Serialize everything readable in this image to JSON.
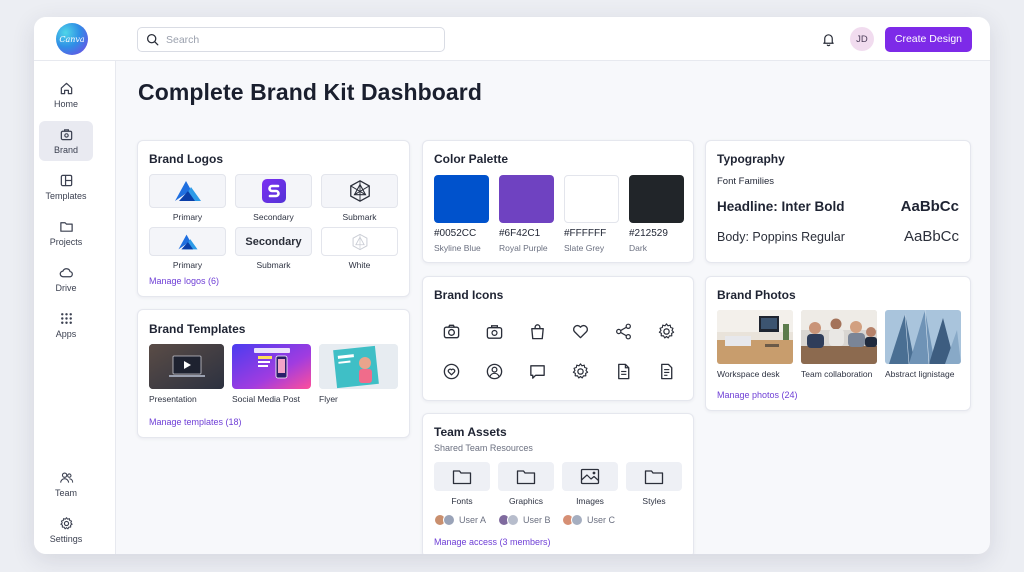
{
  "app": {
    "logo_text": "Canva"
  },
  "search": {
    "placeholder": "Search"
  },
  "header": {
    "avatar_initials": "JD",
    "create_label": "Create Design"
  },
  "sidebar": {
    "items": [
      {
        "label": "Home",
        "icon": "home-icon"
      },
      {
        "label": "Brand",
        "icon": "brand-kit-icon",
        "active": true
      },
      {
        "label": "Templates",
        "icon": "templates-icon"
      },
      {
        "label": "Projects",
        "icon": "folder-icon"
      },
      {
        "label": "Drive",
        "icon": "cloud-icon"
      },
      {
        "label": "Apps",
        "icon": "apps-grid-icon"
      }
    ],
    "bottom_items": [
      {
        "label": "Team",
        "icon": "team-icon"
      },
      {
        "label": "Settings",
        "icon": "gear-icon"
      }
    ]
  },
  "page": {
    "title": "Complete Brand Kit Dashboard"
  },
  "logos": {
    "title": "Brand Logos",
    "tiles": [
      {
        "label": "Primary"
      },
      {
        "label": "Secondary"
      },
      {
        "label": "Submark"
      },
      {
        "label": "Primary"
      },
      {
        "label": "Submark",
        "wordmark": "Secondary"
      },
      {
        "label": "White"
      }
    ],
    "manage": "Manage logos (6)"
  },
  "templates": {
    "title": "Brand Templates",
    "items": [
      {
        "label": "Presentation"
      },
      {
        "label": "Social Media Post"
      },
      {
        "label": "Flyer"
      }
    ],
    "manage": "Manage templates (18)"
  },
  "palette": {
    "title": "Color Palette",
    "colors": [
      {
        "hex": "#0052CC",
        "name": "Skyline Blue"
      },
      {
        "hex": "#6F42C1",
        "name": "Royal Purple"
      },
      {
        "hex": "#FFFFFF",
        "name": "Slate Grey"
      },
      {
        "hex": "#212529",
        "name": "Dark"
      }
    ]
  },
  "icons": {
    "title": "Brand Icons",
    "row1": [
      "camera-icon",
      "briefcase-icon",
      "shopping-bag-icon",
      "heart-icon",
      "share-icon",
      "gear-icon"
    ],
    "row2": [
      "heart-circle-icon",
      "user-circle-icon",
      "chat-icon",
      "settings-icon",
      "document-icon",
      "document-lines-icon"
    ]
  },
  "assets": {
    "title": "Team Assets",
    "subtitle": "Shared Team Resources",
    "folders": [
      {
        "label": "Fonts"
      },
      {
        "label": "Graphics"
      },
      {
        "label": "Images"
      },
      {
        "label": "Styles"
      }
    ],
    "users": [
      "User A",
      "User B",
      "User C"
    ],
    "manage": "Manage access (3 members)"
  },
  "typography": {
    "title": "Typography",
    "families_label": "Font Families",
    "headline": "Headline: Inter Bold",
    "body": "Body: Poppins Regular",
    "sample": "AaBbCc"
  },
  "photos": {
    "title": "Brand Photos",
    "items": [
      {
        "label": "Workspace desk"
      },
      {
        "label": "Team collaboration"
      },
      {
        "label": "Abstract lignistage"
      }
    ],
    "manage": "Manage photos (24)"
  },
  "colors": {
    "accent": "#7D2AE8",
    "link": "#6F3FD6"
  }
}
